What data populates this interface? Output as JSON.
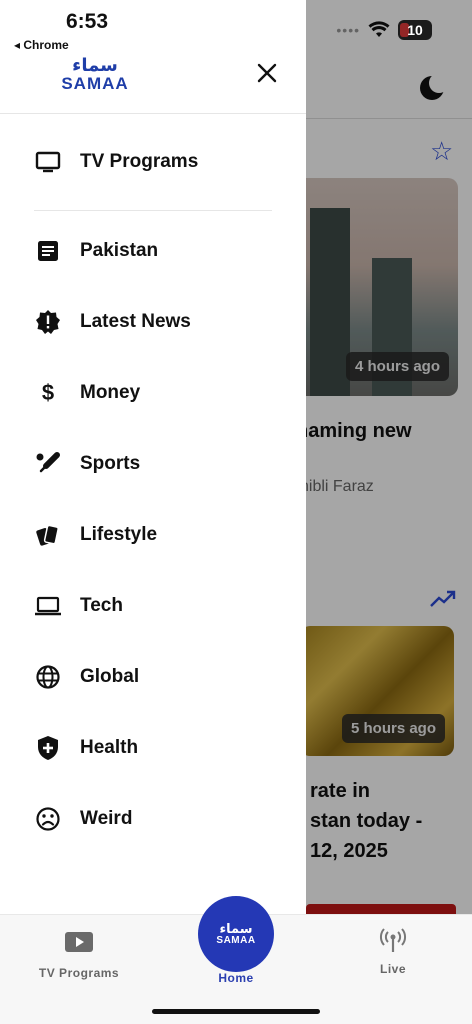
{
  "status_bar": {
    "time": "6:53",
    "back_app": "◂ Chrome",
    "battery": "10"
  },
  "drawer": {
    "logo_urdu": "سماء",
    "logo_text": "SAMAA",
    "primary_item": {
      "label": "TV Programs",
      "icon": "tv-icon"
    },
    "items": [
      {
        "label": "Pakistan",
        "icon": "article-icon"
      },
      {
        "label": "Latest News",
        "icon": "alert-badge-icon"
      },
      {
        "label": "Money",
        "icon": "dollar-icon"
      },
      {
        "label": "Sports",
        "icon": "cricket-bat-icon"
      },
      {
        "label": "Lifestyle",
        "icon": "cards-icon"
      },
      {
        "label": "Tech",
        "icon": "laptop-icon"
      },
      {
        "label": "Global",
        "icon": "globe-icon"
      },
      {
        "label": "Health",
        "icon": "shield-plus-icon"
      },
      {
        "label": "Weird",
        "icon": "sad-face-icon"
      }
    ]
  },
  "background": {
    "story1": {
      "time": "4 hours ago",
      "headline": "naming new",
      "author": "hibli Faraz"
    },
    "story2": {
      "time": "5 hours ago",
      "headline_lines": [
        "rate in",
        "stan today -",
        "12, 2025"
      ]
    }
  },
  "tabbar": {
    "tv_label": "TV Programs",
    "home_label": "Home",
    "home_logo_urdu": "سماء",
    "home_logo_text": "SAMAA",
    "live_label": "Live"
  },
  "colors": {
    "brand": "#2438b5",
    "accent": "#2b4bd6"
  }
}
